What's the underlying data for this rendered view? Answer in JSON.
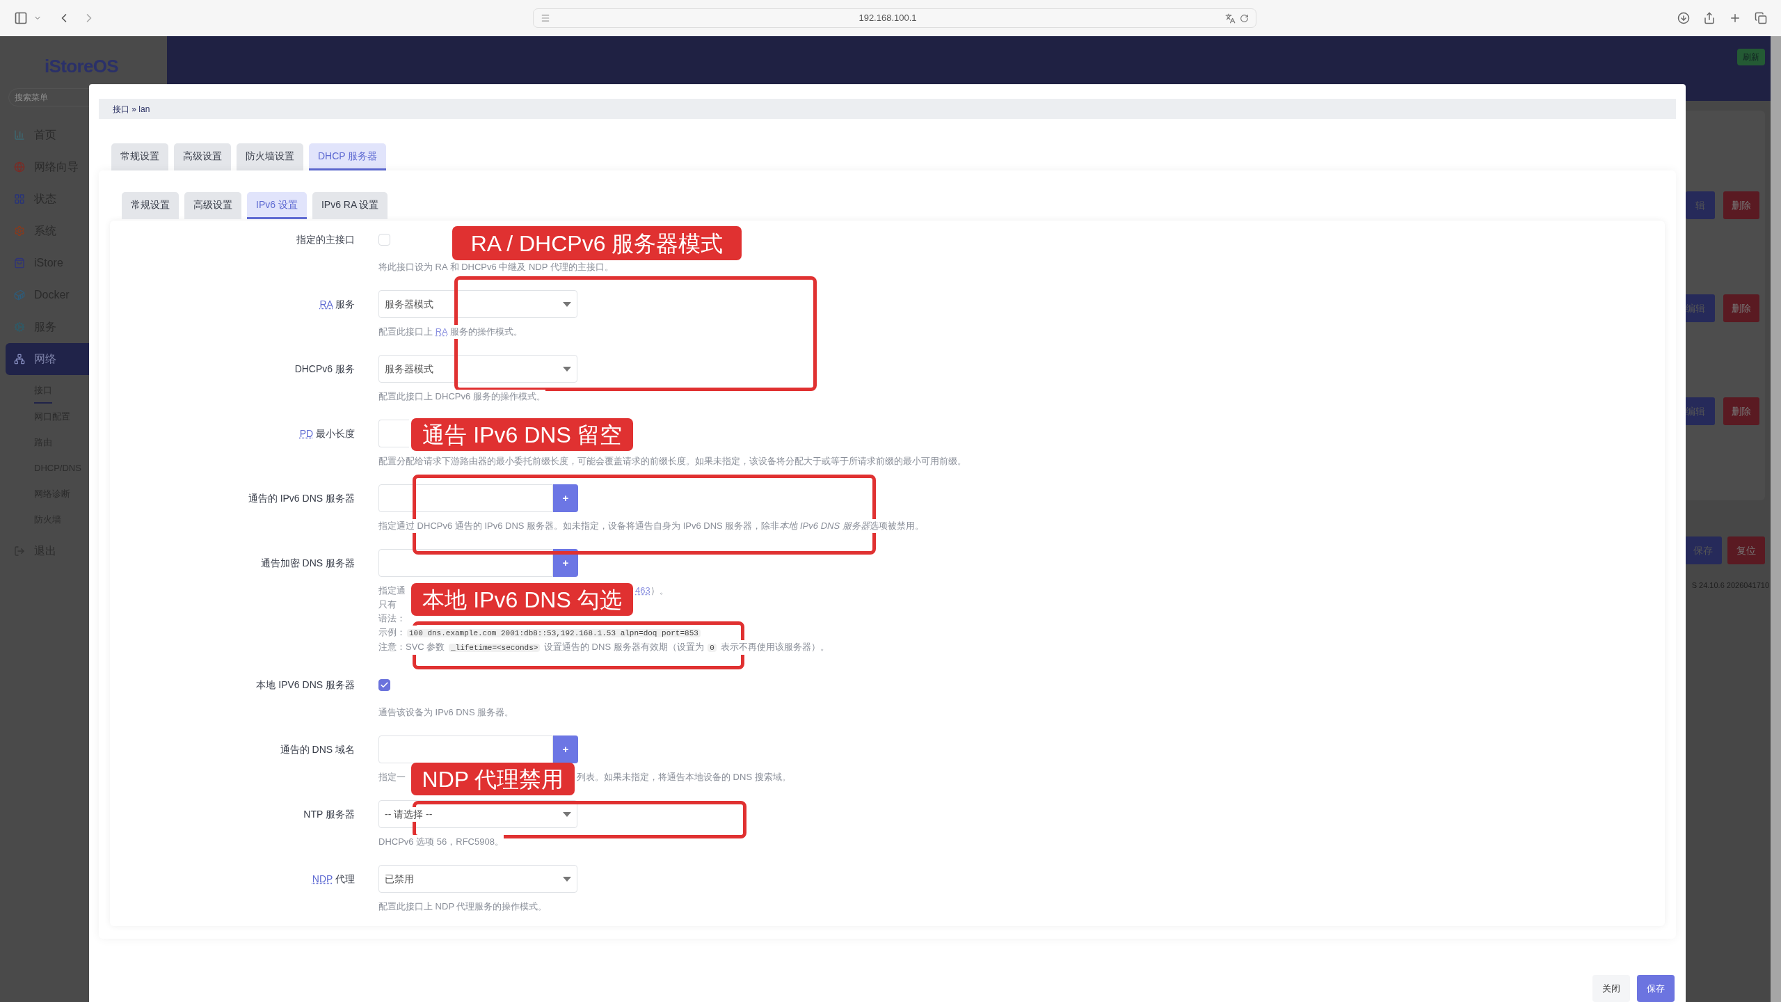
{
  "browser": {
    "url": "192.168.100.1"
  },
  "sidebar": {
    "logo": "iStoreOS",
    "search_placeholder": "搜索菜单",
    "items": [
      {
        "label": "首页",
        "selected": false
      },
      {
        "label": "网络向导",
        "selected": false
      },
      {
        "label": "状态",
        "selected": false
      },
      {
        "label": "系统",
        "selected": false
      },
      {
        "label": "iStore",
        "selected": false
      },
      {
        "label": "Docker",
        "selected": false
      },
      {
        "label": "服务",
        "selected": false
      },
      {
        "label": "网络",
        "selected": true,
        "children": [
          {
            "label": "接口",
            "selected": true
          },
          {
            "label": "网口配置",
            "selected": false
          },
          {
            "label": "路由",
            "selected": false
          },
          {
            "label": "DHCP/DNS",
            "selected": false
          },
          {
            "label": "网络诊断",
            "selected": false
          },
          {
            "label": "防火墙",
            "selected": false
          }
        ]
      },
      {
        "label": "退出",
        "selected": false
      }
    ]
  },
  "header": {
    "refresh_button": "刷新"
  },
  "background": {
    "rows": [
      {
        "edit": "辑",
        "delete": "删除"
      },
      {
        "edit": "编辑",
        "delete": "删除"
      },
      {
        "edit": "编辑",
        "delete": "删除"
      }
    ],
    "save": "保存",
    "reset": "复位",
    "version": "S 24.10.6 2026041710"
  },
  "modal": {
    "breadcrumb": "接口 » lan",
    "tabs": [
      {
        "label": "常规设置",
        "selected": false
      },
      {
        "label": "高级设置",
        "selected": false
      },
      {
        "label": "防火墙设置",
        "selected": false
      },
      {
        "label": "DHCP 服务器",
        "selected": true
      }
    ],
    "subtabs": [
      {
        "label": "常规设置",
        "selected": false
      },
      {
        "label": "高级设置",
        "selected": false
      },
      {
        "label": "IPv6 设置",
        "selected": true
      },
      {
        "label": "IPv6 RA 设置",
        "selected": false
      }
    ],
    "fields": [
      {
        "kind": "checkbox",
        "label": "指定的主接口",
        "checked": false,
        "help": [
          [
            {
              "kind": "text",
              "text": "将此接口设为 RA 和 DHCPv6 中继及 NDP 代理的主接口。"
            }
          ]
        ]
      },
      {
        "kind": "select",
        "abbr": "RA",
        "label": "服务",
        "value": "服务器模式",
        "help": [
          [
            {
              "kind": "text",
              "text": "配置此接口上 "
            },
            {
              "kind": "link",
              "text": "RA"
            },
            {
              "kind": "text",
              "text": " 服务的操作模式。"
            }
          ]
        ]
      },
      {
        "kind": "select",
        "label": "DHCPv6 服务",
        "value": "服务器模式",
        "help": [
          [
            {
              "kind": "text",
              "text": "配置此接口上 DHCPv6 服务的操作模式。"
            }
          ]
        ]
      },
      {
        "kind": "input",
        "abbr": "PD",
        "label": "最小长度",
        "help": [
          [
            {
              "kind": "text",
              "text": "配置分配给请求下游路由器的最小委托前缀长度，可能会覆盖请求的前缀长度。如果未指定，该设备将分配大于或等于所请求前缀的最小可用前缀。"
            }
          ]
        ]
      },
      {
        "kind": "dynlist",
        "label": "通告的 IPv6 DNS 服务器",
        "add_button": "+",
        "help": [
          [
            {
              "kind": "text",
              "text": "指定通过 DHCPv6 通告的 IPv6 DNS 服务器。如未指定，设备将通告自身为 IPv6 DNS 服务器，除非"
            },
            {
              "kind": "italic",
              "text": "本地 IPv6 DNS 服务器"
            },
            {
              "kind": "text",
              "text": "选项被禁用。"
            }
          ]
        ]
      },
      {
        "kind": "dynlist",
        "label": "通告加密 DNS 服务器",
        "add_button": "+",
        "help": [
          [
            {
              "kind": "text",
              "text": "指定通"
            },
            {
              "kind": "covered"
            },
            {
              "kind": "link",
              "text": "463"
            },
            {
              "kind": "text",
              "text": "）。"
            }
          ],
          [
            {
              "kind": "text",
              "text": "只有"
            }
          ],
          [
            {
              "kind": "text",
              "text": "语法："
            }
          ],
          [
            {
              "kind": "text",
              "text": "示例："
            },
            {
              "kind": "code",
              "text": "100 dns.example.com 2001:db8::53,192.168.1.53 alpn=doq port=853"
            }
          ],
          [
            {
              "kind": "text",
              "text": "注意："
            },
            {
              "kind": "text",
              "text": "SVC 参数 "
            },
            {
              "kind": "code",
              "text": "_lifetime=<seconds>"
            },
            {
              "kind": "text",
              "text": " 设置通告的 DNS 服务器有效期（设置为 "
            },
            {
              "kind": "code",
              "text": "0"
            },
            {
              "kind": "text",
              "text": " 表示不再使用该服务器）。"
            }
          ]
        ]
      },
      {
        "kind": "checkbox",
        "label": "本地 IPV6 DNS 服务器",
        "checked": true,
        "help": [
          [
            {
              "kind": "text",
              "text": "通告该设备为 IPv6 DNS 服务器。"
            }
          ]
        ]
      },
      {
        "kind": "dynlist",
        "label": "通告的 DNS 域名",
        "add_button": "+",
        "help": [
          [
            {
              "kind": "text",
              "text": "指定一"
            },
            {
              "kind": "covered_narrow"
            },
            {
              "kind": "text",
              "text": "列表。如果未指定，将通告本地设备的 DNS 搜索域。"
            }
          ]
        ]
      },
      {
        "kind": "select",
        "label": "NTP 服务器",
        "value": "-- 请选择 --",
        "help": [
          [
            {
              "kind": "text",
              "text": "DHCPv6 选项 56，RFC5908。"
            }
          ]
        ]
      },
      {
        "kind": "select",
        "abbr": "NDP",
        "label": "代理",
        "value": "已禁用",
        "help": [
          [
            {
              "kind": "text",
              "text": "配置此接口上 NDP 代理服务的操作模式。"
            }
          ]
        ]
      }
    ],
    "footer_buttons": [
      {
        "label": "关闭",
        "kind": "secondary"
      },
      {
        "label": "保存",
        "kind": "primary"
      }
    ]
  },
  "annotations": [
    {
      "label": "RA / DHCPv6 服务器模式"
    },
    {
      "label": "通告 IPv6 DNS 留空"
    },
    {
      "label": "本地 IPv6 DNS 勾选"
    },
    {
      "label": "NDP 代理禁用"
    }
  ]
}
